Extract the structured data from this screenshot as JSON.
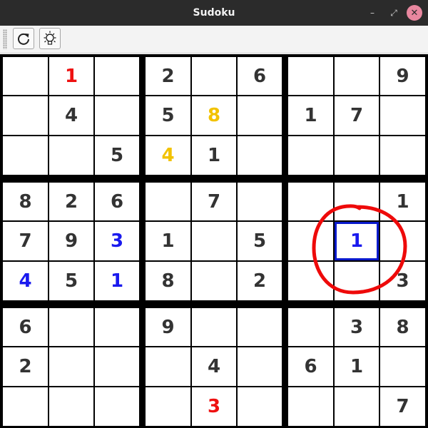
{
  "window": {
    "title": "Sudoku"
  },
  "toolbar": {
    "buttons": [
      {
        "name": "refresh-button",
        "icon": "refresh-icon"
      },
      {
        "name": "hint-button",
        "icon": "lightbulb-icon"
      }
    ]
  },
  "colors": {
    "given": "#333333",
    "error": "#ee1111",
    "hint": "#f2c200",
    "user": "#1a1aee",
    "selection": "#0a1acc",
    "annotation": "#ee0a0a"
  },
  "board": {
    "rows": [
      [
        [
          "",
          ""
        ],
        [
          "1",
          "error"
        ],
        [
          "",
          ""
        ],
        [
          "2",
          "given"
        ],
        [
          "",
          ""
        ],
        [
          "6",
          "given"
        ],
        [
          "",
          ""
        ],
        [
          "",
          ""
        ],
        [
          "9",
          "given"
        ]
      ],
      [
        [
          "",
          ""
        ],
        [
          "4",
          "given"
        ],
        [
          "",
          ""
        ],
        [
          "5",
          "given"
        ],
        [
          "8",
          "hint"
        ],
        [
          "",
          ""
        ],
        [
          "1",
          "given"
        ],
        [
          "7",
          "given"
        ],
        [
          "",
          ""
        ]
      ],
      [
        [
          "",
          ""
        ],
        [
          "",
          ""
        ],
        [
          "5",
          "given"
        ],
        [
          "4",
          "hint"
        ],
        [
          "1",
          "given"
        ],
        [
          "",
          ""
        ],
        [
          "",
          ""
        ],
        [
          "",
          ""
        ],
        [
          "",
          ""
        ]
      ],
      [
        [
          "8",
          "given"
        ],
        [
          "2",
          "given"
        ],
        [
          "6",
          "given"
        ],
        [
          "",
          ""
        ],
        [
          "7",
          "given"
        ],
        [
          "",
          ""
        ],
        [
          "",
          ""
        ],
        [
          "",
          ""
        ],
        [
          "1",
          "given"
        ]
      ],
      [
        [
          "7",
          "given"
        ],
        [
          "9",
          "given"
        ],
        [
          "3",
          "user"
        ],
        [
          "1",
          "given"
        ],
        [
          "",
          ""
        ],
        [
          "5",
          "given"
        ],
        [
          "",
          ""
        ],
        [
          "1",
          "user"
        ],
        [
          "",
          ""
        ]
      ],
      [
        [
          "4",
          "user"
        ],
        [
          "5",
          "given"
        ],
        [
          "1",
          "user"
        ],
        [
          "8",
          "given"
        ],
        [
          "",
          ""
        ],
        [
          "2",
          "given"
        ],
        [
          "",
          ""
        ],
        [
          "",
          ""
        ],
        [
          "3",
          "given"
        ]
      ],
      [
        [
          "6",
          "given"
        ],
        [
          "",
          ""
        ],
        [
          "",
          ""
        ],
        [
          "9",
          "given"
        ],
        [
          "",
          ""
        ],
        [
          "",
          ""
        ],
        [
          "",
          ""
        ],
        [
          "3",
          "given"
        ],
        [
          "8",
          "given"
        ]
      ],
      [
        [
          "2",
          "given"
        ],
        [
          "",
          ""
        ],
        [
          "",
          ""
        ],
        [
          "",
          ""
        ],
        [
          "4",
          "given"
        ],
        [
          "",
          ""
        ],
        [
          "6",
          "given"
        ],
        [
          "1",
          "given"
        ],
        [
          "",
          ""
        ]
      ],
      [
        [
          "",
          ""
        ],
        [
          "",
          ""
        ],
        [
          "",
          ""
        ],
        [
          "",
          ""
        ],
        [
          "3",
          "error"
        ],
        [
          "",
          ""
        ],
        [
          "",
          ""
        ],
        [
          "",
          ""
        ],
        [
          "7",
          "given"
        ]
      ]
    ],
    "selected": {
      "row": 4,
      "col": 7
    },
    "annotation": {
      "shape": "circle",
      "row": 4,
      "col": 7
    }
  }
}
